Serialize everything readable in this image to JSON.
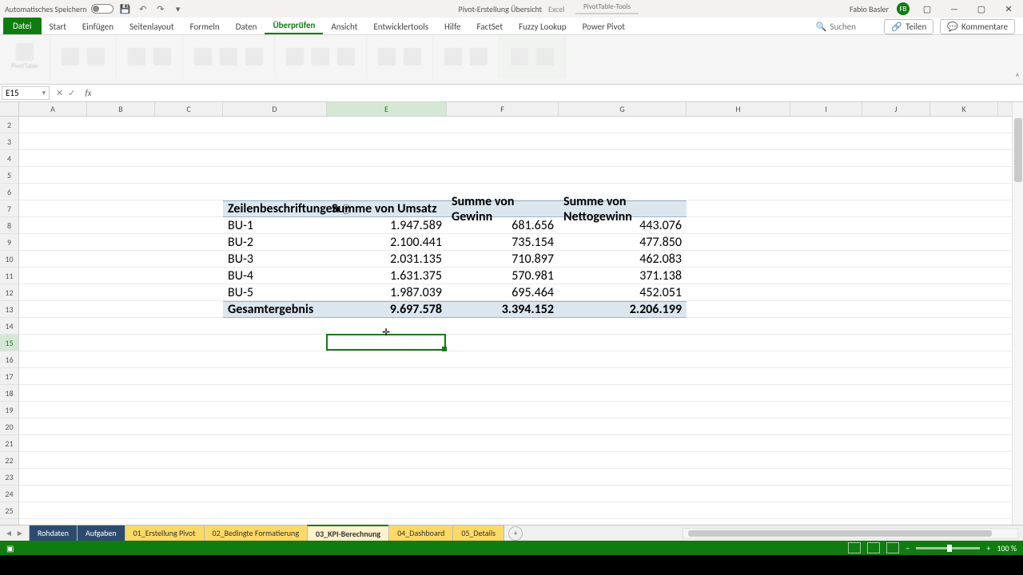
{
  "titlebar": {
    "autosave_label": "Automatisches Speichern",
    "doc_title": "Pivot-Erstellung Übersicht",
    "app_name": "Excel",
    "context_tab": "PivotTable-Tools",
    "user_name": "Fabio Basler",
    "user_initials": "FB"
  },
  "ribbon": {
    "tabs": [
      "Datei",
      "Start",
      "Einfügen",
      "Seitenlayout",
      "Formeln",
      "Daten",
      "Überprüfen",
      "Ansicht",
      "Entwicklertools",
      "Hilfe",
      "FactSet",
      "Fuzzy Lookup",
      "Power Pivot"
    ],
    "active_tab_index": 6,
    "search_placeholder": "Suchen",
    "share_label": "Teilen",
    "comments_label": "Kommentare"
  },
  "formula_bar": {
    "name_box": "E15",
    "formula": ""
  },
  "columns": [
    {
      "label": "A",
      "width": 85
    },
    {
      "label": "B",
      "width": 85
    },
    {
      "label": "C",
      "width": 85
    },
    {
      "label": "D",
      "width": 130
    },
    {
      "label": "E",
      "width": 150
    },
    {
      "label": "F",
      "width": 140
    },
    {
      "label": "G",
      "width": 160
    },
    {
      "label": "H",
      "width": 130
    },
    {
      "label": "I",
      "width": 90
    },
    {
      "label": "J",
      "width": 85
    },
    {
      "label": "K",
      "width": 85
    }
  ],
  "selected_col": "E",
  "rows_start": 2,
  "rows_end": 25,
  "selected_row": 15,
  "pivot": {
    "start_col_index": 3,
    "header_row": 7,
    "row_label_header": "Zeilenbeschriftungen",
    "value_headers": [
      "Summe von Umsatz",
      "Summe von Gewinn",
      "Summe von Nettogewinn"
    ],
    "rows": [
      {
        "label": "BU-1",
        "values": [
          "1.947.589",
          "681.656",
          "443.076"
        ]
      },
      {
        "label": "BU-2",
        "values": [
          "2.100.441",
          "735.154",
          "477.850"
        ]
      },
      {
        "label": "BU-3",
        "values": [
          "2.031.135",
          "710.897",
          "462.083"
        ]
      },
      {
        "label": "BU-4",
        "values": [
          "1.631.375",
          "570.981",
          "371.138"
        ]
      },
      {
        "label": "BU-5",
        "values": [
          "1.987.039",
          "695.464",
          "452.051"
        ]
      }
    ],
    "total_label": "Gesamtergebnis",
    "totals": [
      "9.697.578",
      "3.394.152",
      "2.206.199"
    ]
  },
  "sheets": {
    "tabs": [
      {
        "name": "Rohdaten",
        "style": "dark"
      },
      {
        "name": "Aufgaben",
        "style": "dark"
      },
      {
        "name": "01_Erstellung Pivot",
        "style": "yellow"
      },
      {
        "name": "02_Bedingte Formatierung",
        "style": "yellow"
      },
      {
        "name": "03_KPI-Berechnung",
        "style": "yellow",
        "active": true
      },
      {
        "name": "04_Dashboard",
        "style": "yellow"
      },
      {
        "name": "05_Details",
        "style": "yellow"
      }
    ]
  },
  "status": {
    "zoom": "100 %"
  }
}
